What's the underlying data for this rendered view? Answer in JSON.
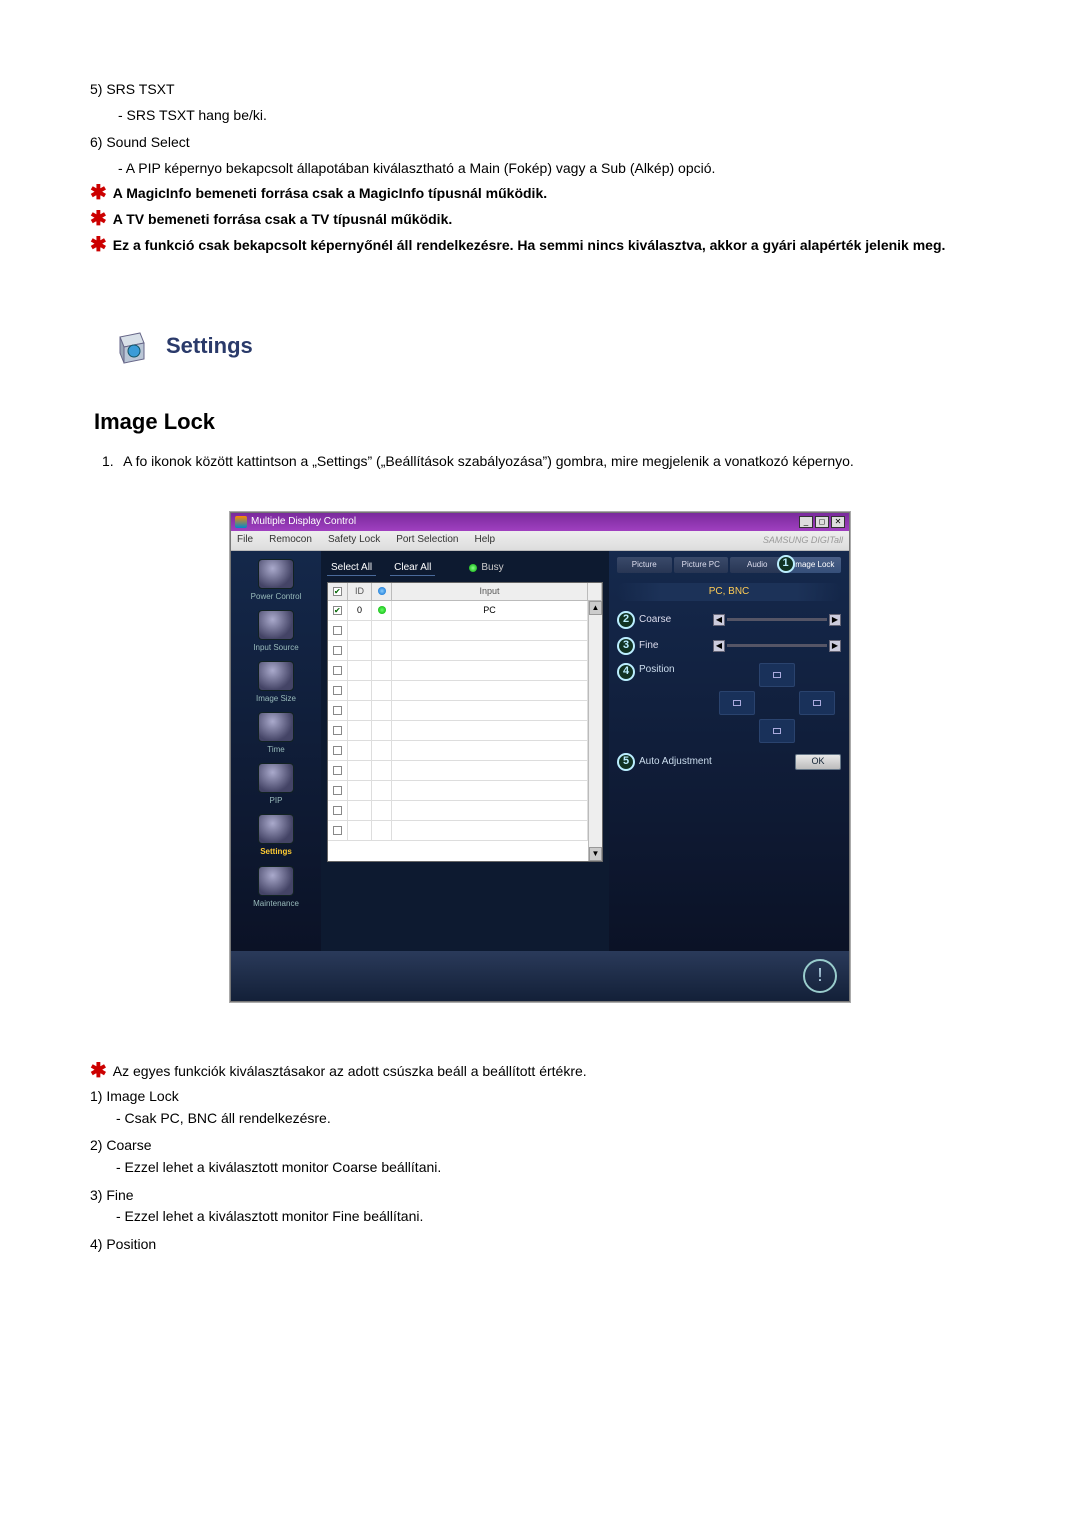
{
  "items": {
    "n5": "5)",
    "t5": "SRS TSXT",
    "d5": "- SRS TSXT hang be/ki.",
    "n6": "6)",
    "t6": "Sound Select",
    "d6": "- A PIP képernyo bekapcsolt állapotában kiválasztható a Main (Fokép) vagy a Sub (Alkép) opció."
  },
  "stars": {
    "s1": "A MagicInfo bemeneti forrása csak a MagicInfo típusnál működik.",
    "s2": "A TV bemeneti forrása csak a TV típusnál működik.",
    "s3": "Ez a funkció csak bekapcsolt képernyőnél áll rendelkezésre. Ha semmi nincs kiválasztva, akkor a gyári alapérték jelenik meg."
  },
  "settings_heading": "Settings",
  "section_heading": "Image Lock",
  "step1": {
    "num": "1.",
    "text": "A fo ikonok között kattintson a „Settings” („Beállítások szabályozása”) gombra, mire megjelenik a vonatkozó képernyo."
  },
  "app": {
    "title": "Multiple Display Control",
    "menu": {
      "file": "File",
      "remocon": "Remocon",
      "safety": "Safety Lock",
      "port": "Port Selection",
      "help": "Help"
    },
    "brand": "SAMSUNG DIGITall",
    "sidebar": {
      "power": "Power Control",
      "input": "Input Source",
      "size": "Image Size",
      "time": "Time",
      "pip": "PIP",
      "settings": "Settings",
      "maint": "Maintenance"
    },
    "actions": {
      "select_all": "Select All",
      "clear_all": "Clear All",
      "busy": "Busy"
    },
    "grid": {
      "h_id": "ID",
      "h_input": "Input",
      "r1_id": "0",
      "r1_input": "PC"
    },
    "right": {
      "tabs": {
        "picture": "Picture",
        "picturepc": "Picture PC",
        "audio": "Audio",
        "imagelock": "Image Lock"
      },
      "group": "PC, BNC",
      "coarse": "Coarse",
      "fine": "Fine",
      "position": "Position",
      "auto": "Auto Adjustment",
      "ok": "OK",
      "b1": "1",
      "b2": "2",
      "b3": "3",
      "b4": "4",
      "b5": "5"
    }
  },
  "bottom_star": "Az egyes funkciók kiválasztásakor az adott csúszka beáll a beállított értékre.",
  "bottom": {
    "n1": "1)",
    "t1": "Image Lock",
    "d1": "- Csak PC, BNC áll rendelkezésre.",
    "n2": "2)",
    "t2": "Coarse",
    "d2": "- Ezzel lehet a kiválasztott monitor Coarse beállítani.",
    "n3": "3)",
    "t3": "Fine",
    "d3": "- Ezzel lehet a kiválasztott monitor Fine beállítani.",
    "n4": "4)",
    "t4": "Position"
  }
}
